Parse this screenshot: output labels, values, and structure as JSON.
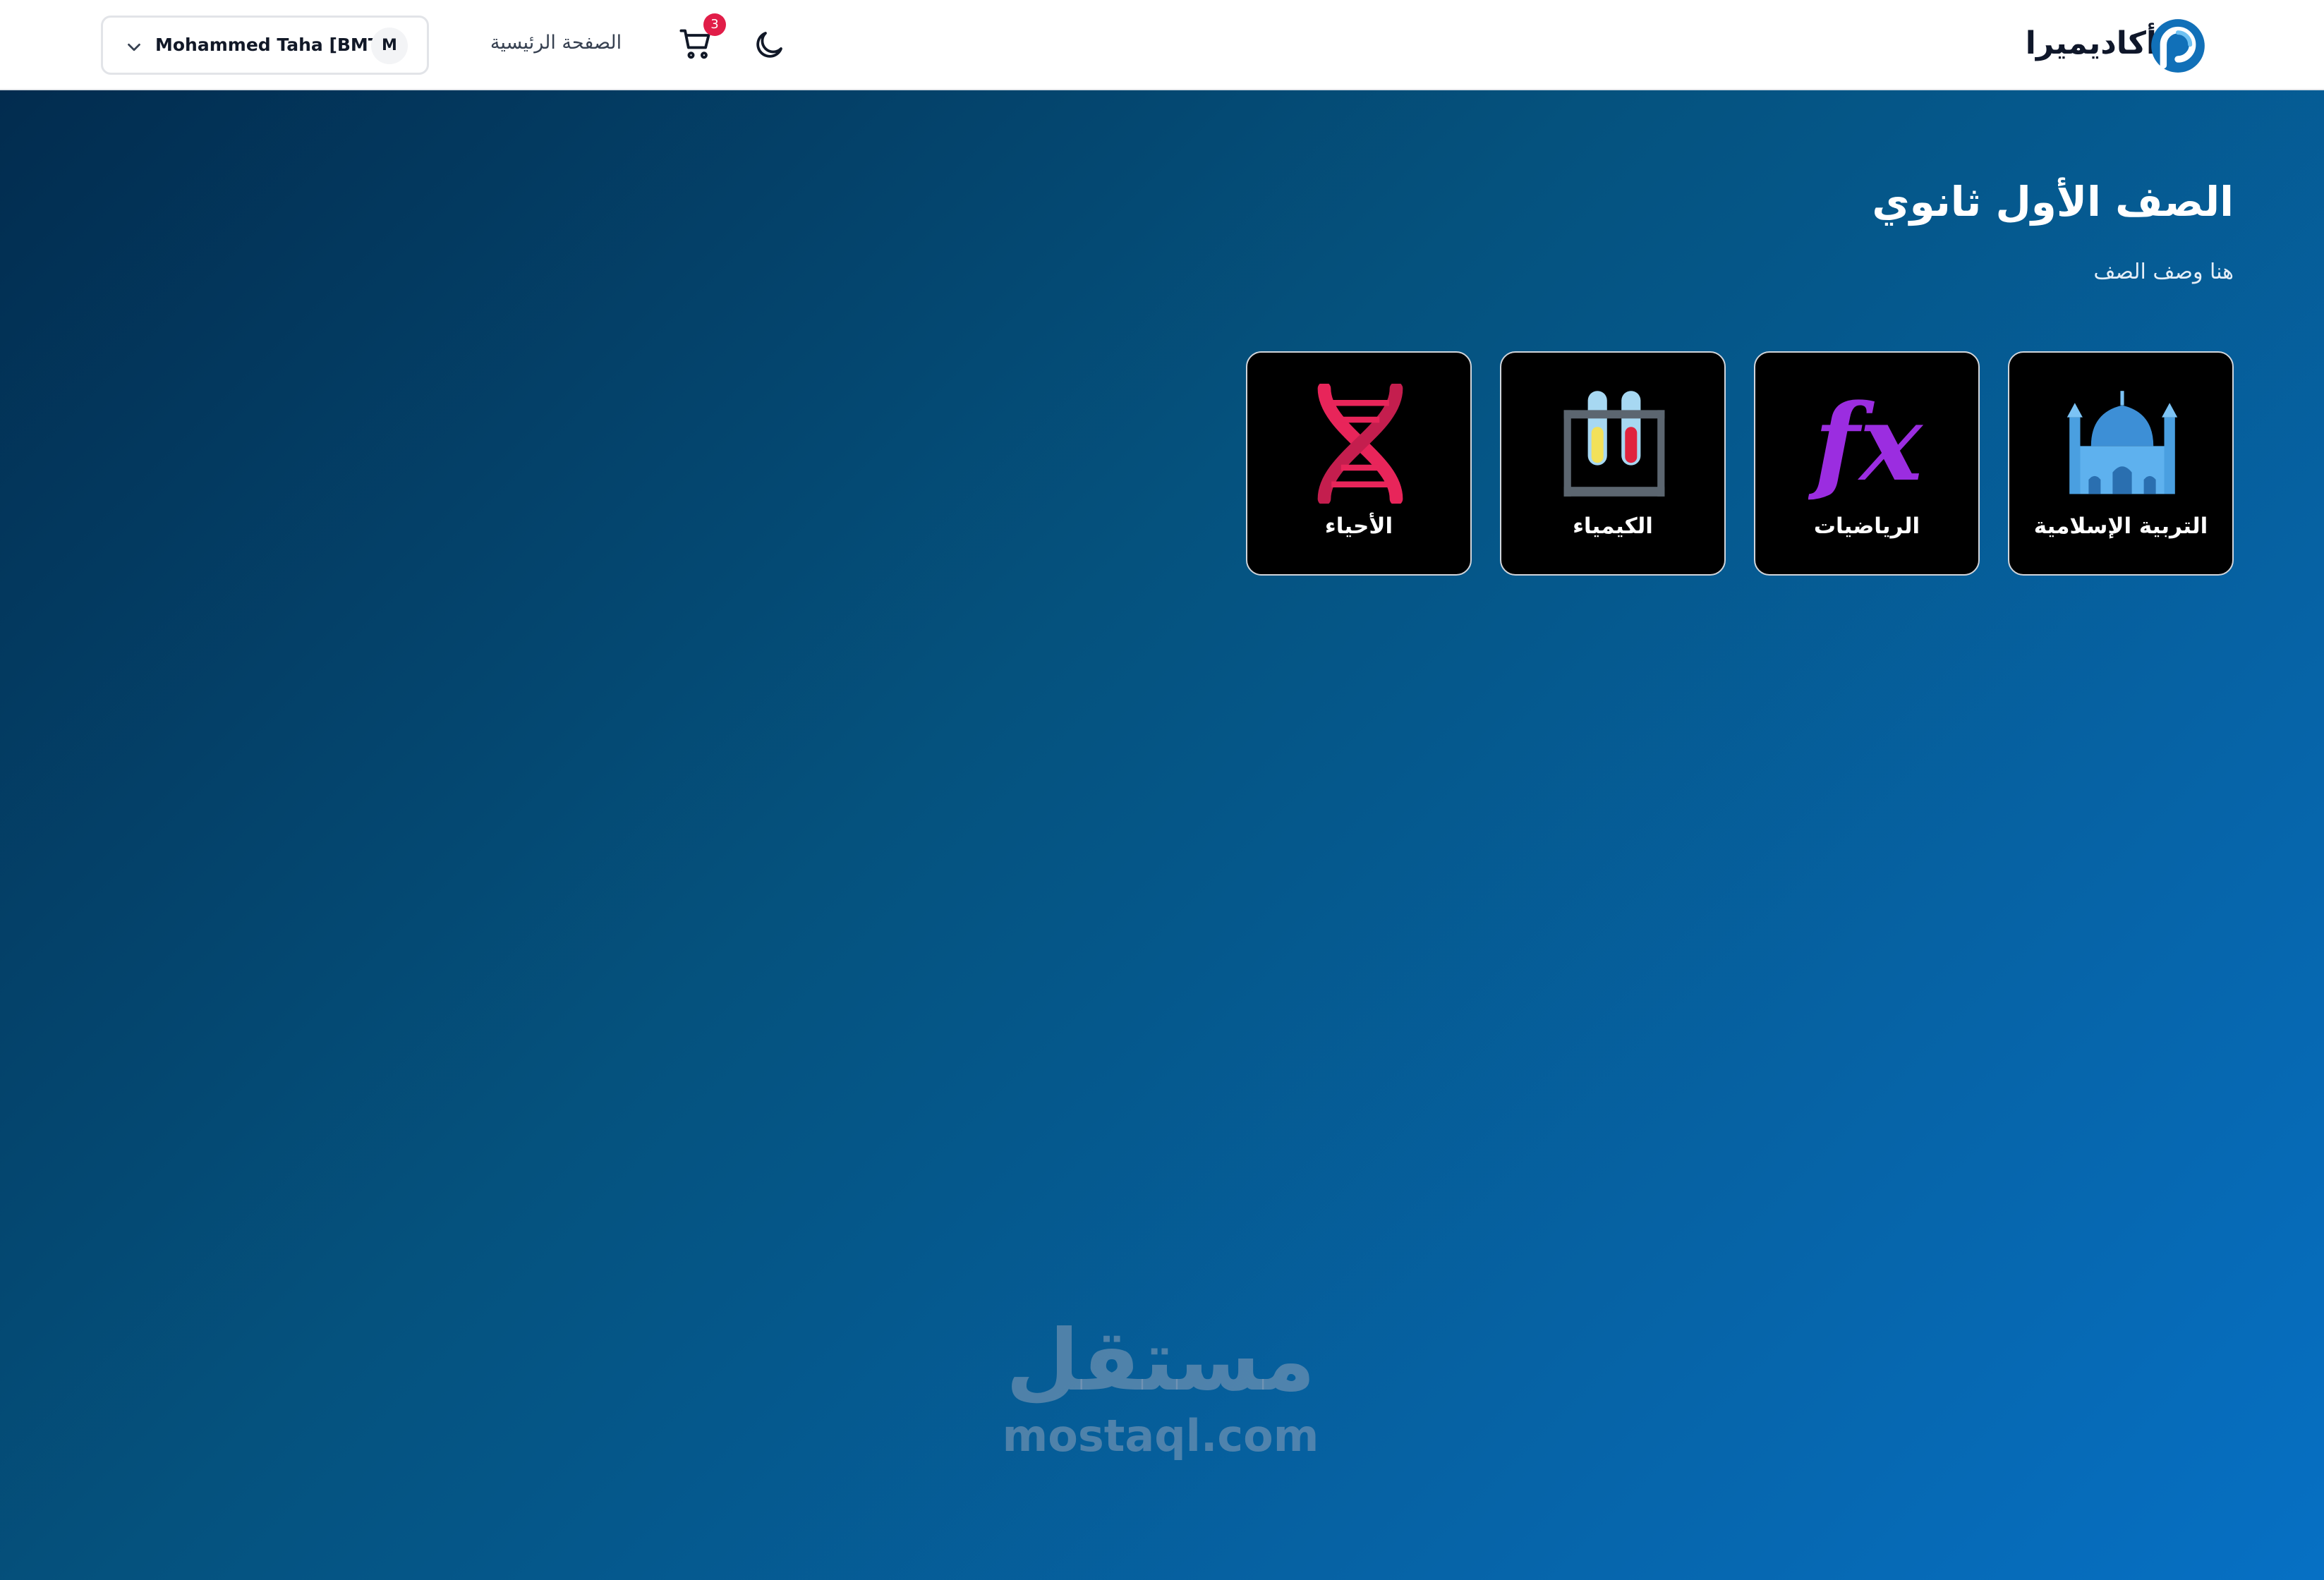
{
  "navbar": {
    "brand_name": "أكاديميرا",
    "home_link": "الصفحة الرئيسية",
    "cart_count": "3",
    "user": {
      "name": "Mohammed Taha [BMT]",
      "avatar_initial": "M"
    }
  },
  "page": {
    "title": "الصف الأول ثانوي",
    "description": "هنا وصف الصف"
  },
  "subjects": [
    {
      "label": "التربية الإسلامية",
      "icon": "mosque-icon"
    },
    {
      "label": "الرياضيات",
      "icon": "fx-function-icon"
    },
    {
      "label": "الكيمياء",
      "icon": "test-tubes-icon"
    },
    {
      "label": "الأحياء",
      "icon": "dna-icon"
    }
  ],
  "watermark": {
    "arabic": "مستقل",
    "latin": "mostaql.com"
  },
  "colors": {
    "hero_gradient_start": "#022c4f",
    "hero_gradient_end": "#0670c4",
    "cart_badge": "#e11d48",
    "brand_blue": "#1170b8"
  }
}
